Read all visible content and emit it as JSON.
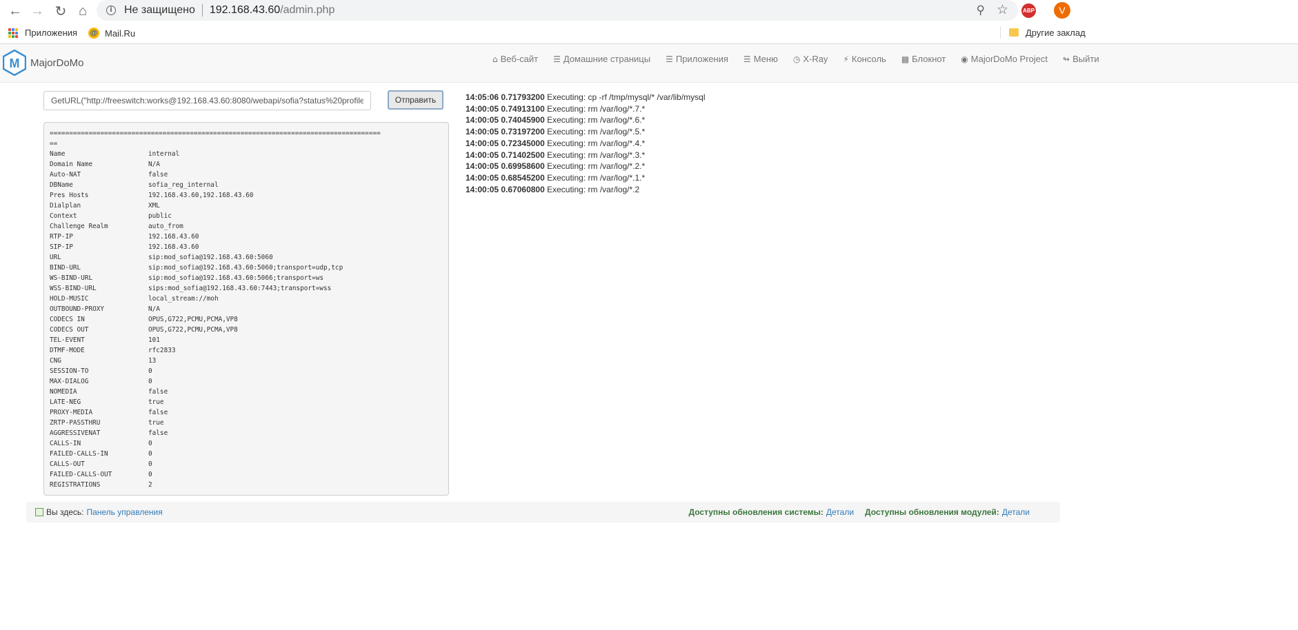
{
  "browser": {
    "security_label": "Не защищено",
    "url_host": "192.168.43.60",
    "url_path": "/admin.php",
    "bookmarks": [
      {
        "label": "Приложения",
        "icon": "apps-grid-icon"
      },
      {
        "label": "Mail.Ru",
        "icon": "mailru-icon"
      }
    ],
    "other_bookmarks": "Другие заклад",
    "abp_label": "ABP",
    "avatar_letter": "V"
  },
  "app": {
    "brand": "MajorDoMo",
    "brand_letter": "M",
    "nav": [
      {
        "label": "Веб-сайт",
        "icon": "home-icon"
      },
      {
        "label": "Домашние страницы",
        "icon": "list-icon"
      },
      {
        "label": "Приложения",
        "icon": "list-icon"
      },
      {
        "label": "Меню",
        "icon": "list-icon"
      },
      {
        "label": "X-Ray",
        "icon": "dashboard-icon"
      },
      {
        "label": "Консоль",
        "icon": "flash-icon"
      },
      {
        "label": "Блокнот",
        "icon": "book-icon"
      },
      {
        "label": "MajorDoMo Project",
        "icon": "globe-icon"
      },
      {
        "label": "Выйти",
        "icon": "logout-icon"
      }
    ]
  },
  "console": {
    "command": "GetURL(\"http://freeswitch:works@192.168.43.60:8080/webapi/sofia?status%20profile%",
    "submit_label": "Отправить",
    "separator": "=====================================================================================",
    "separator_tail": "==",
    "rows": [
      [
        "Name",
        "internal"
      ],
      [
        "Domain Name",
        "N/A"
      ],
      [
        "Auto-NAT",
        "false"
      ],
      [
        "DBName",
        "sofia_reg_internal"
      ],
      [
        "Pres Hosts",
        "192.168.43.60,192.168.43.60"
      ],
      [
        "Dialplan",
        "XML"
      ],
      [
        "Context",
        "public"
      ],
      [
        "Challenge Realm",
        "auto_from"
      ],
      [
        "RTP-IP",
        "192.168.43.60"
      ],
      [
        "SIP-IP",
        "192.168.43.60"
      ],
      [
        "URL",
        "sip:mod_sofia@192.168.43.60:5060"
      ],
      [
        "BIND-URL",
        "sip:mod_sofia@192.168.43.60:5060;transport=udp,tcp"
      ],
      [
        "WS-BIND-URL",
        "sip:mod_sofia@192.168.43.60:5066;transport=ws"
      ],
      [
        "WSS-BIND-URL",
        "sips:mod_sofia@192.168.43.60:7443;transport=wss"
      ],
      [
        "HOLD-MUSIC",
        "local_stream://moh"
      ],
      [
        "OUTBOUND-PROXY",
        "N/A"
      ],
      [
        "CODECS IN",
        "OPUS,G722,PCMU,PCMA,VP8"
      ],
      [
        "CODECS OUT",
        "OPUS,G722,PCMU,PCMA,VP8"
      ],
      [
        "TEL-EVENT",
        "101"
      ],
      [
        "DTMF-MODE",
        "rfc2833"
      ],
      [
        "CNG",
        "13"
      ],
      [
        "SESSION-TO",
        "0"
      ],
      [
        "MAX-DIALOG",
        "0"
      ],
      [
        "NOMEDIA",
        "false"
      ],
      [
        "LATE-NEG",
        "true"
      ],
      [
        "PROXY-MEDIA",
        "false"
      ],
      [
        "ZRTP-PASSTHRU",
        "true"
      ],
      [
        "AGGRESSIVENAT",
        "false"
      ],
      [
        "CALLS-IN",
        "0"
      ],
      [
        "FAILED-CALLS-IN",
        "0"
      ],
      [
        "CALLS-OUT",
        "0"
      ],
      [
        "FAILED-CALLS-OUT",
        "0"
      ],
      [
        "REGISTRATIONS",
        "2"
      ]
    ]
  },
  "log": [
    {
      "time": "14:05:06 0.71793200",
      "text": "Executing: cp -rf /tmp/mysql/* /var/lib/mysql"
    },
    {
      "time": "14:00:05 0.74913100",
      "text": "Executing: rm /var/log/*.7.*"
    },
    {
      "time": "14:00:05 0.74045900",
      "text": "Executing: rm /var/log/*.6.*"
    },
    {
      "time": "14:00:05 0.73197200",
      "text": "Executing: rm /var/log/*.5.*"
    },
    {
      "time": "14:00:05 0.72345000",
      "text": "Executing: rm /var/log/*.4.*"
    },
    {
      "time": "14:00:05 0.71402500",
      "text": "Executing: rm /var/log/*.3.*"
    },
    {
      "time": "14:00:05 0.69958600",
      "text": "Executing: rm /var/log/*.2.*"
    },
    {
      "time": "14:00:05 0.68545200",
      "text": "Executing: rm /var/log/*.1.*"
    },
    {
      "time": "14:00:05 0.67060800",
      "text": "Executing: rm /var/log/*.2"
    }
  ],
  "footer": {
    "here_label": "Вы здесь:",
    "here_link": "Панель управления",
    "system_updates": "Доступны обновления системы:",
    "system_updates_link": "Детали",
    "module_updates": "Доступны обновления модулей:",
    "module_updates_link": "Детали"
  },
  "colors": {
    "accent_link": "#337ab7",
    "update_green": "#3c763d",
    "brand_blue": "#3b8fd1"
  }
}
